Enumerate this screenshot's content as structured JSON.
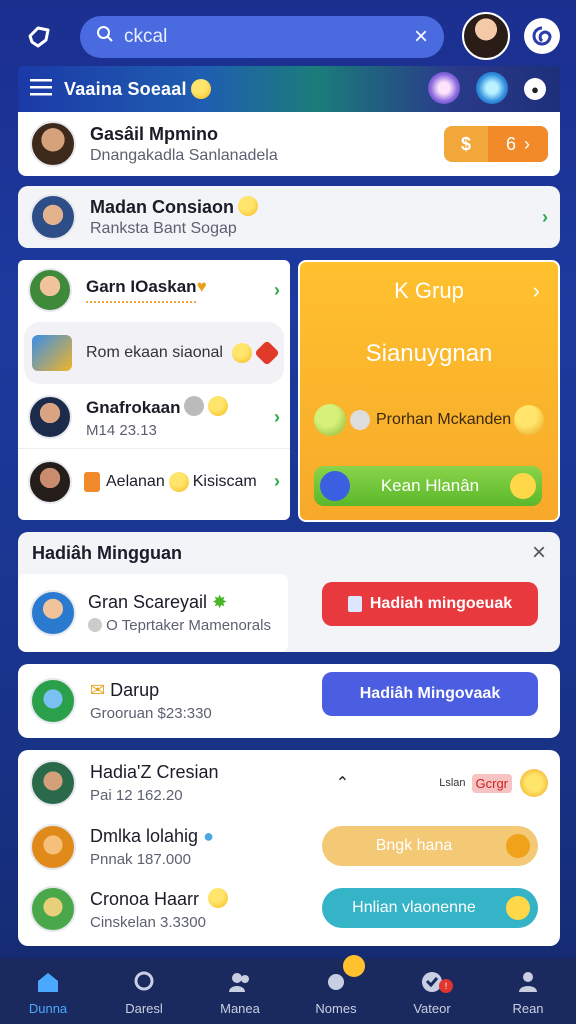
{
  "topbar": {
    "search_value": "ckcal",
    "clear_glyph": "×"
  },
  "banner": {
    "title": "Vaaina Soeaal"
  },
  "friends": [
    {
      "name": "Gasâil Mpmino",
      "sub": "Dnangakadla Sanlanadela",
      "action_badge": "6"
    },
    {
      "name": "Madan Consiaon",
      "sub": "Ranksta Bant Sogap"
    }
  ],
  "list_left": [
    {
      "name": "Garn IOaskan",
      "sub": ""
    },
    {
      "name": "Rom ekaan siaonal",
      "sub": ""
    },
    {
      "name": "Gnafrokaan",
      "sub": "M14 23.13"
    },
    {
      "name": "Aelanan",
      "sub": "Kisiscam"
    }
  ],
  "group_card": {
    "title": "K Grup",
    "subtitle": "Sianuygnan",
    "promo": "Prorhan Mckanden",
    "button": "Kean Hlanân"
  },
  "hadiah": {
    "header": "Hadiâh Mingguan",
    "close_glyph": "×",
    "items": [
      {
        "name": "Gran Scareyail",
        "sub": "O Teprtaker Mamenorals",
        "button": "Hadiah mingoeuak",
        "button_color": "#e8393f"
      },
      {
        "name": "Darup",
        "sub": "Grooruan $23:330",
        "button": "Hadiâh Mingovaak",
        "button_color": "#4b5de0"
      }
    ]
  },
  "bottom_list": [
    {
      "name": "Hadia'Z Cresian",
      "sub": "Pai 12 162.20",
      "extra": "Lslan",
      "tag": "Gcrgr"
    },
    {
      "name": "Dmlka lolahig",
      "sub": "Pnnak 187.000",
      "button": "Bngk hana",
      "button_color": "#f3c976"
    },
    {
      "name": "Cronoa Haarr",
      "sub": "Cinskelan 3.3300",
      "button": "Hnlian vlaonenne",
      "button_color": "#35b4c7"
    }
  ],
  "nav": [
    {
      "label": "Dunna",
      "icon": "home-icon",
      "active": true
    },
    {
      "label": "Daresl",
      "icon": "search-chat-icon"
    },
    {
      "label": "Manea",
      "icon": "people-icon"
    },
    {
      "label": "Nomes",
      "icon": "coins-icon"
    },
    {
      "label": "Vateor",
      "icon": "heart-icon"
    },
    {
      "label": "Rean",
      "icon": "profile-icon"
    }
  ],
  "colors": {
    "accent_green": "#2fa84a",
    "accent_orange": "#f2a73a",
    "nav_active": "#4aa8ff"
  }
}
